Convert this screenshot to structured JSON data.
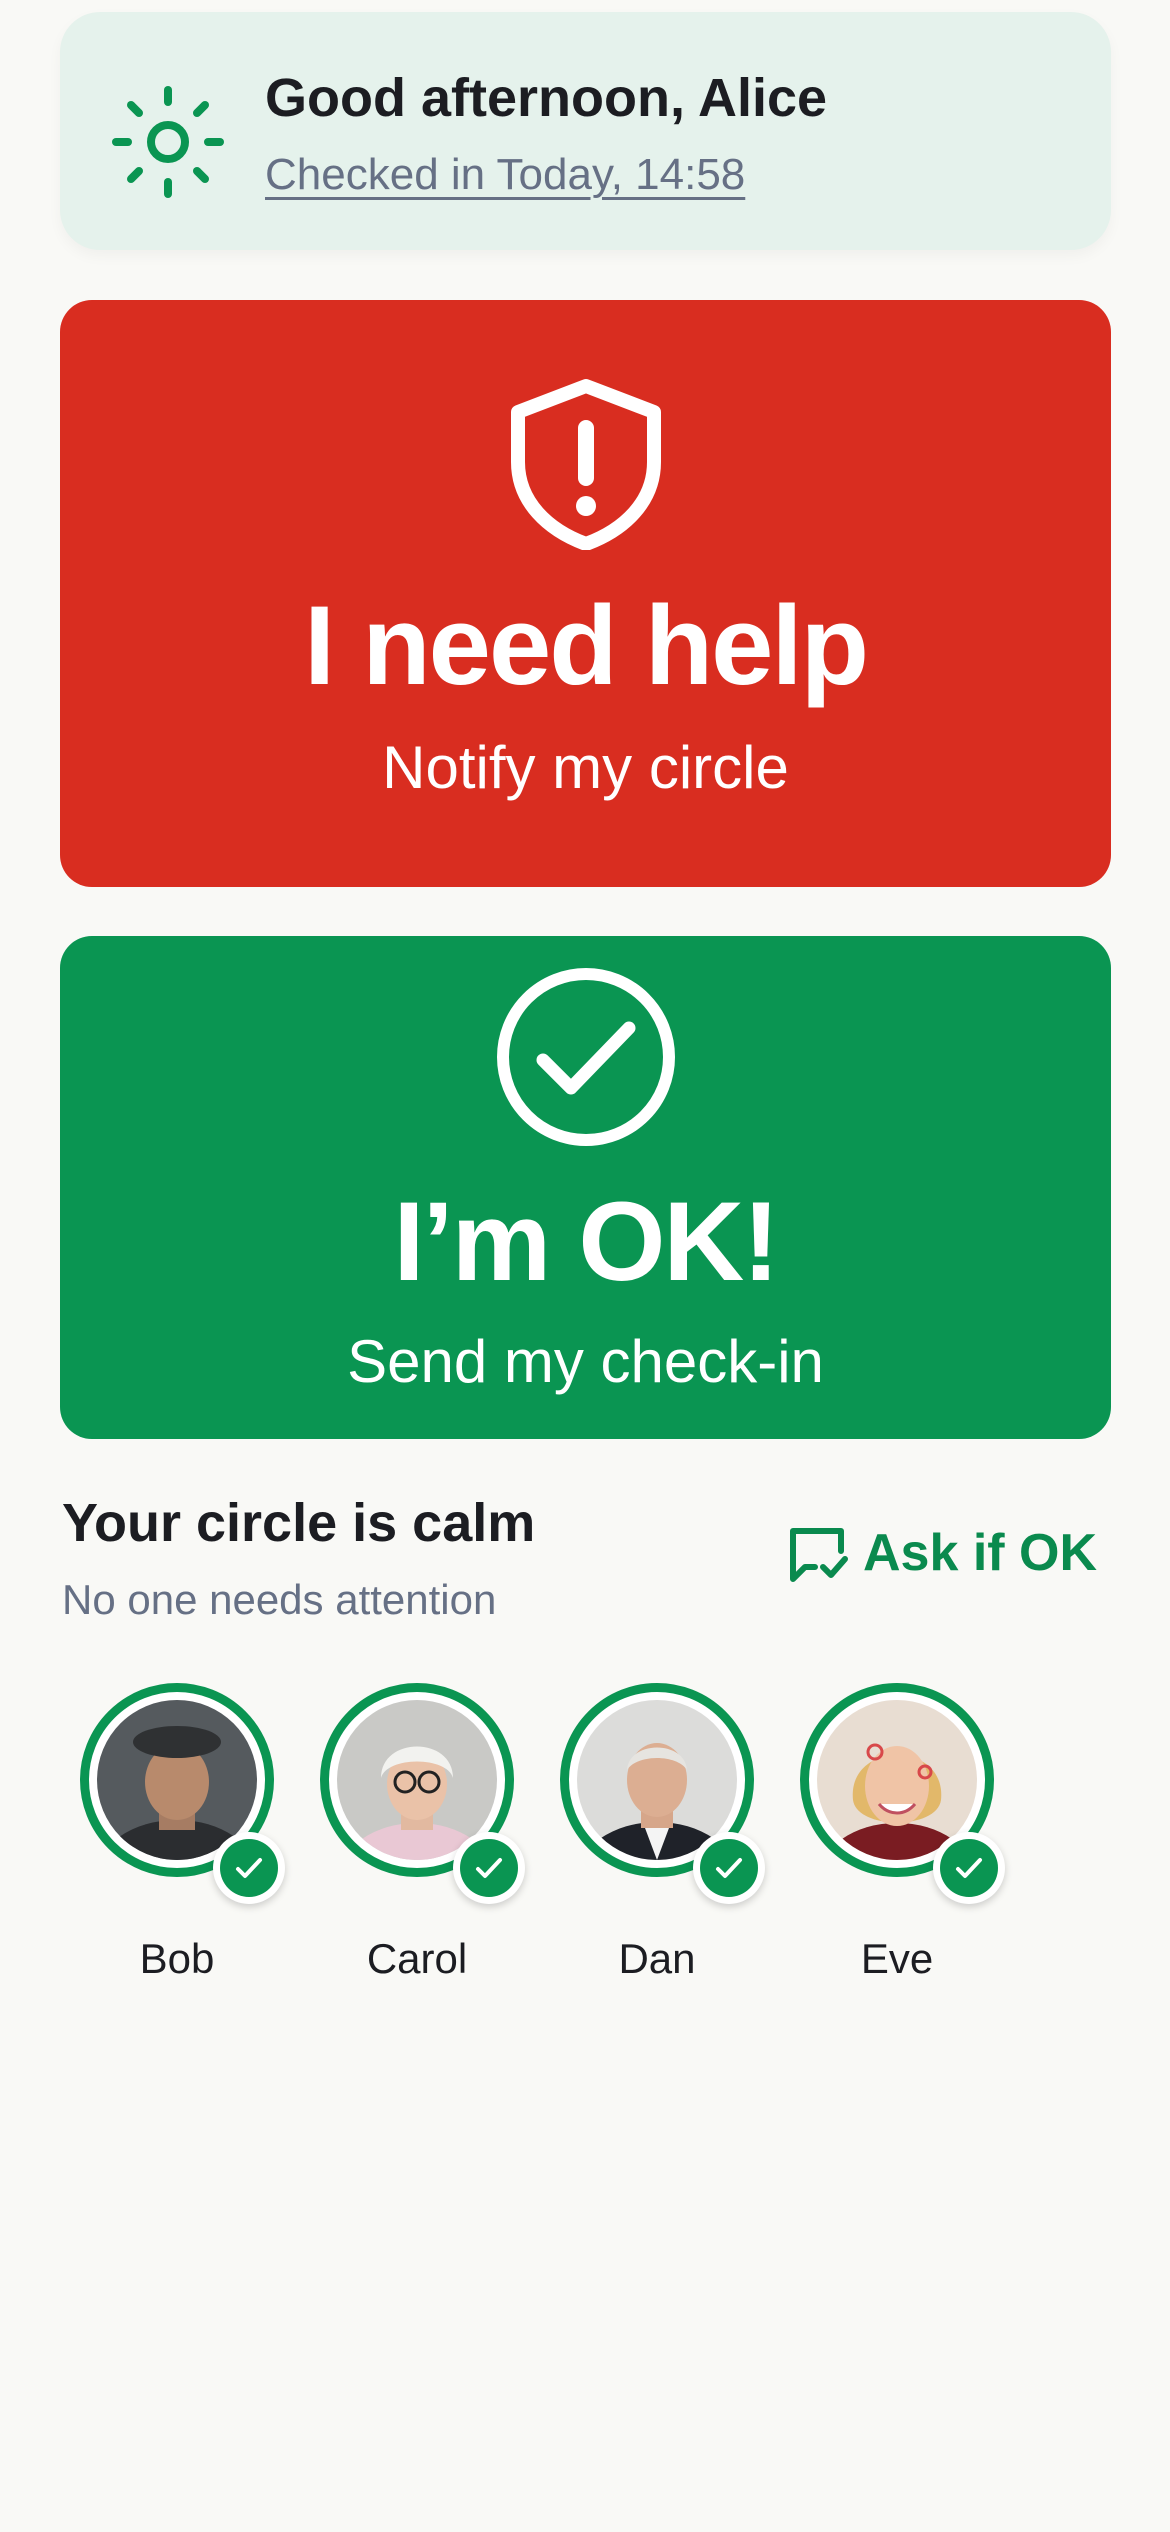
{
  "greeting": {
    "title": "Good afternoon, Alice",
    "checkin": "Checked in Today, 14:58",
    "icon": "sun-icon"
  },
  "help_button": {
    "title": "I need help",
    "subtitle": "Notify my circle",
    "icon": "shield-alert-icon",
    "color": "#d92d20"
  },
  "ok_button": {
    "title": "I’m OK!",
    "subtitle": "Send my check-in",
    "icon": "check-circle-icon",
    "color": "#0a9552"
  },
  "circle": {
    "title": "Your circle is calm",
    "subtitle": "No one needs attention",
    "ask_label": "Ask if OK",
    "ask_icon": "message-check-icon",
    "contacts": [
      {
        "name": "Bob",
        "status": "checked-in"
      },
      {
        "name": "Carol",
        "status": "checked-in"
      },
      {
        "name": "Dan",
        "status": "checked-in"
      },
      {
        "name": "Eve",
        "status": "checked-in"
      }
    ]
  },
  "colors": {
    "accent_green": "#0a9552",
    "alert_red": "#d92d20",
    "greeting_bg": "#e5f2ec",
    "muted_text": "#667085"
  }
}
